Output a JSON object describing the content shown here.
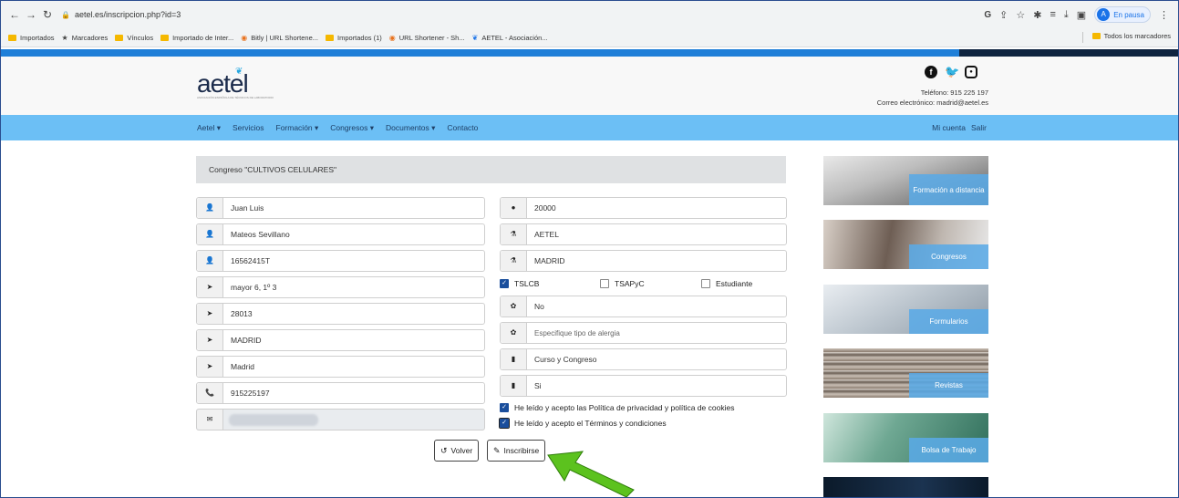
{
  "browser": {
    "url": "aetel.es/inscripcion.php?id=3",
    "paused_label": "En pausa",
    "bookmarks": [
      {
        "label": "Importados",
        "icon": "folder-icon"
      },
      {
        "label": "Marcadores",
        "icon": "star-icon"
      },
      {
        "label": "Vínculos",
        "icon": "folder-icon"
      },
      {
        "label": "Importado de Inter...",
        "icon": "folder-icon"
      },
      {
        "label": "Bitly | URL Shortene...",
        "icon": "bitly-icon"
      },
      {
        "label": "Importados (1)",
        "icon": "folder-icon"
      },
      {
        "label": "URL Shortener - Sh...",
        "icon": "bitly-icon"
      },
      {
        "label": "AETEL - Asociación...",
        "icon": "aetel-icon"
      }
    ],
    "all_bookmarks": "Todos los marcadores"
  },
  "site": {
    "logo_text": "aetel",
    "logo_sub": "ASOCIACIÓN ESPAÑOLA DE TÉCNICOS DE LABORATORIO",
    "phone": "Teléfono: 915 225 197",
    "email": "Correo electrónico: madrid@aetel.es",
    "menu": [
      {
        "label": "Aetel ▾"
      },
      {
        "label": "Servicios"
      },
      {
        "label": "Formación ▾"
      },
      {
        "label": "Congresos ▾"
      },
      {
        "label": "Documentos ▾"
      },
      {
        "label": "Contacto"
      }
    ],
    "menu_right": [
      "Mi cuenta",
      "Salir"
    ]
  },
  "form": {
    "title": "Congreso \"CULTIVOS CELULARES\"",
    "left": [
      "Juan Luis",
      "Mateos Sevillano",
      "16562415T",
      "mayor 6, 1º 3",
      "28013",
      "MADRID",
      "Madrid",
      "915225197"
    ],
    "right": {
      "code": "20000",
      "org": "AETEL",
      "city": "MADRID",
      "allergy": "No",
      "allergy_placeholder": "Especifique tipo de alergia",
      "course": "Curso y Congreso",
      "yes": "Si"
    },
    "checks": {
      "tslcb": "TSLCB",
      "tsapyc": "TSAPyC",
      "student": "Estudiante"
    },
    "privacy": "He leído y acepto las Política de privacidad y política de cookies",
    "terms": "He leído y acepto el Términos y condiciones",
    "back_label": "Volver",
    "submit_label": "Inscribirse"
  },
  "sidebar": [
    {
      "label": "Formación a distancia",
      "color": "#8a8a8a"
    },
    {
      "label": "Congresos",
      "color": "#5d5048"
    },
    {
      "label": "Formularios",
      "color": "#9aa6b3"
    },
    {
      "label": "Revistas",
      "color": "#7d6f62"
    },
    {
      "label": "Bolsa de Trabajo",
      "color": "#3f7f6a"
    }
  ],
  "colors": {
    "accent": "#6cbff5",
    "stripe": "#1f7fd8",
    "arrow": "#5cc21e"
  }
}
